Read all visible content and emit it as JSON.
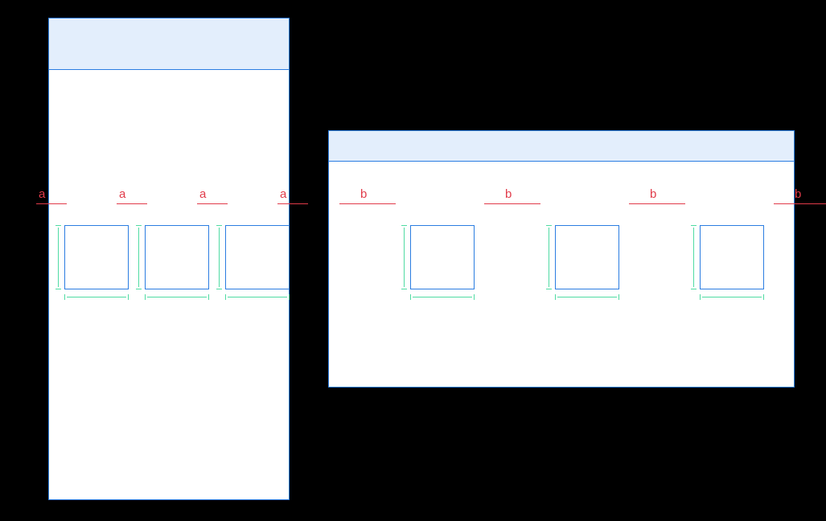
{
  "left_panel": {
    "labels": [
      "a",
      "a",
      "a",
      "a"
    ]
  },
  "right_panel": {
    "labels": [
      "b",
      "b",
      "b",
      "b"
    ]
  }
}
